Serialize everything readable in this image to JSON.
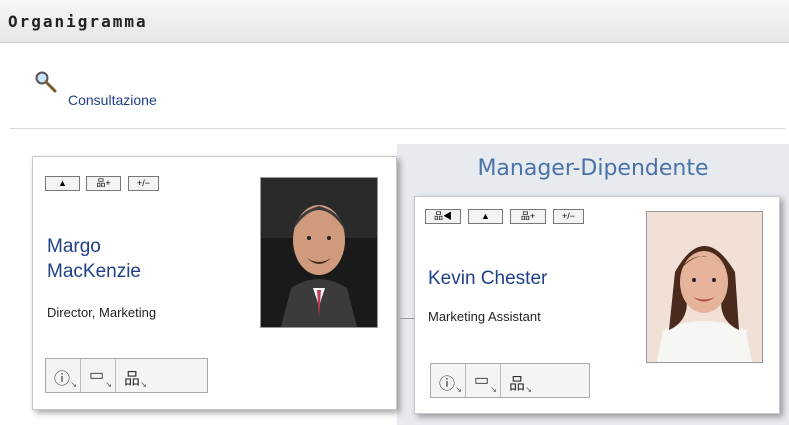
{
  "page": {
    "title": "Organigramma"
  },
  "search": {
    "link_label": "Consultazione"
  },
  "panel": {
    "title": "Manager-Dipendente"
  },
  "cards": {
    "manager": {
      "name_line1": "Margo",
      "name_line2": "MacKenzie",
      "role": "Director, Marketing",
      "buttons": [
        "up-arrow",
        "expand-org",
        "plus-minus"
      ],
      "actions": [
        "info-icon",
        "message-icon",
        "org-chart-icon"
      ]
    },
    "employee": {
      "name": "Kevin Chester",
      "role": "Marketing Assistant",
      "buttons": [
        "go-to-manager",
        "up-arrow",
        "expand-org",
        "plus-minus"
      ],
      "actions": [
        "info-icon",
        "message-icon",
        "org-chart-icon"
      ]
    }
  },
  "colors": {
    "accent": "#1f3f86",
    "panel_title": "#4a72a8",
    "panel_bg": "#e7ebf0"
  }
}
